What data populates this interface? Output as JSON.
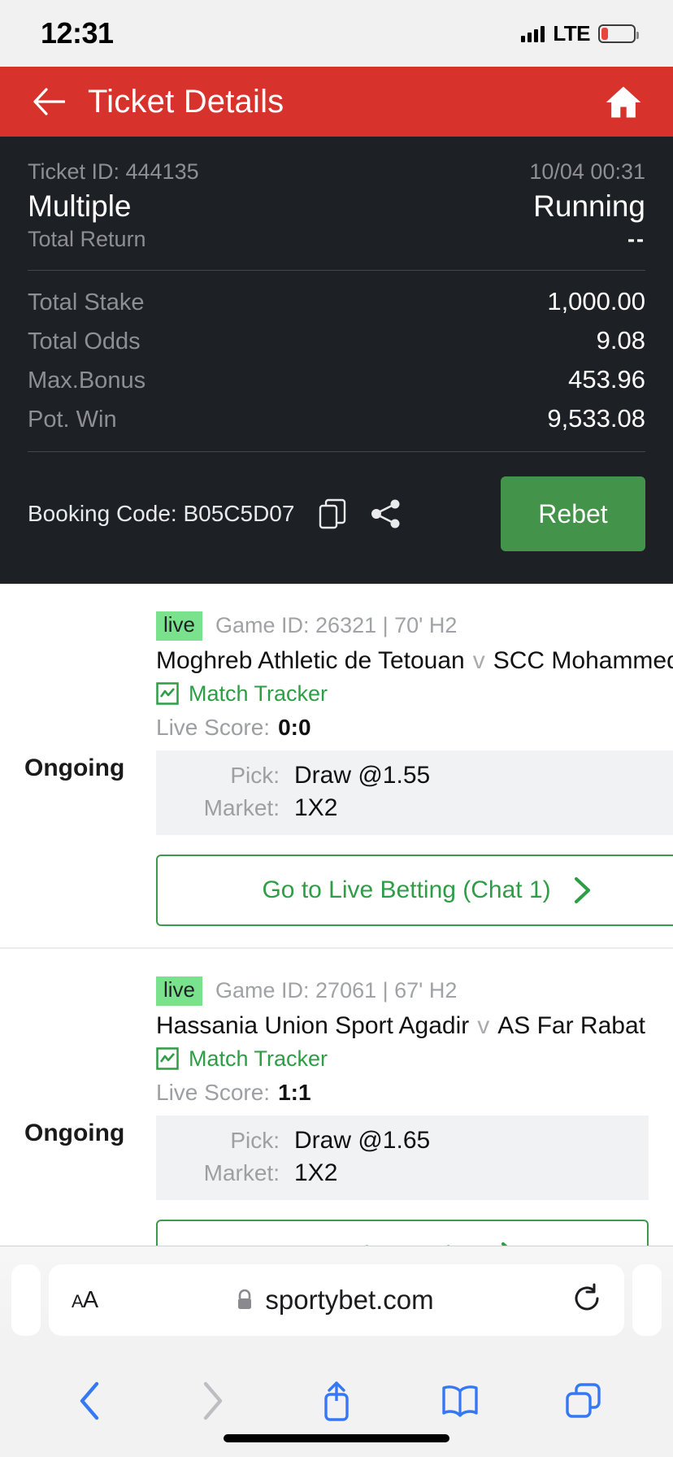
{
  "status_bar": {
    "time": "12:31",
    "network": "LTE",
    "battery_level_percent": 22
  },
  "app_header": {
    "title": "Ticket Details",
    "back_icon": "arrow-left-icon",
    "home_icon": "home-icon",
    "background_color": "#d8322c"
  },
  "ticket_summary": {
    "ticket_id_label": "Ticket ID: 444135",
    "placed_at": "10/04 00:31",
    "bet_type": "Multiple",
    "status": "Running",
    "total_return_label": "Total Return",
    "total_return_value": "--",
    "rows": [
      {
        "label": "Total Stake",
        "value": "1,000.00"
      },
      {
        "label": "Total Odds",
        "value": "9.08"
      },
      {
        "label": "Max.Bonus",
        "value": "453.96"
      },
      {
        "label": "Pot. Win",
        "value": "9,533.08"
      }
    ],
    "booking_code_text": "Booking Code: B05C5D07",
    "copy_icon": "copy-icon",
    "share_icon": "share-icon",
    "rebet_label": "Rebet",
    "rebet_color": "#43934a",
    "background_color": "#1d2024"
  },
  "events": [
    {
      "status": "Ongoing",
      "live_badge": "live",
      "game_meta": "Game ID: 26321 | 70' H2",
      "home_team": "Moghreb Athletic de Tetouan",
      "versus": "v",
      "away_team": "SCC Mohammedia",
      "tracker_label": "Match Tracker",
      "tracker_icon": "chart-line-icon",
      "score_label": "Live Score:",
      "score_value": "0:0",
      "pick_label": "Pick:",
      "pick_value": "Draw @1.55",
      "market_label": "Market:",
      "market_value": "1X2",
      "cta_label": "Go to Live Betting (Chat 1)",
      "cta_icon": "chevron-right-icon"
    },
    {
      "status": "Ongoing",
      "live_badge": "live",
      "game_meta": "Game ID: 27061 | 67' H2",
      "home_team": "Hassania Union Sport Agadir",
      "versus": "v",
      "away_team": "AS Far Rabat",
      "tracker_label": "Match Tracker",
      "tracker_icon": "chart-line-icon",
      "score_label": "Live Score:",
      "score_value": "1:1",
      "pick_label": "Pick:",
      "pick_value": "Draw @1.65",
      "market_label": "Market:",
      "market_value": "1X2",
      "cta_label": "Go to Live Betting",
      "cta_icon": "chevron-right-icon"
    }
  ],
  "browser": {
    "text_size_label": "AA",
    "lock_icon": "lock-icon",
    "url": "sportybet.com",
    "reload_icon": "reload-icon",
    "back_icon": "chevron-left-icon",
    "forward_icon": "chevron-right-icon",
    "share_icon": "share-up-icon",
    "bookmarks_icon": "book-icon",
    "tabs_icon": "tabs-icon"
  }
}
